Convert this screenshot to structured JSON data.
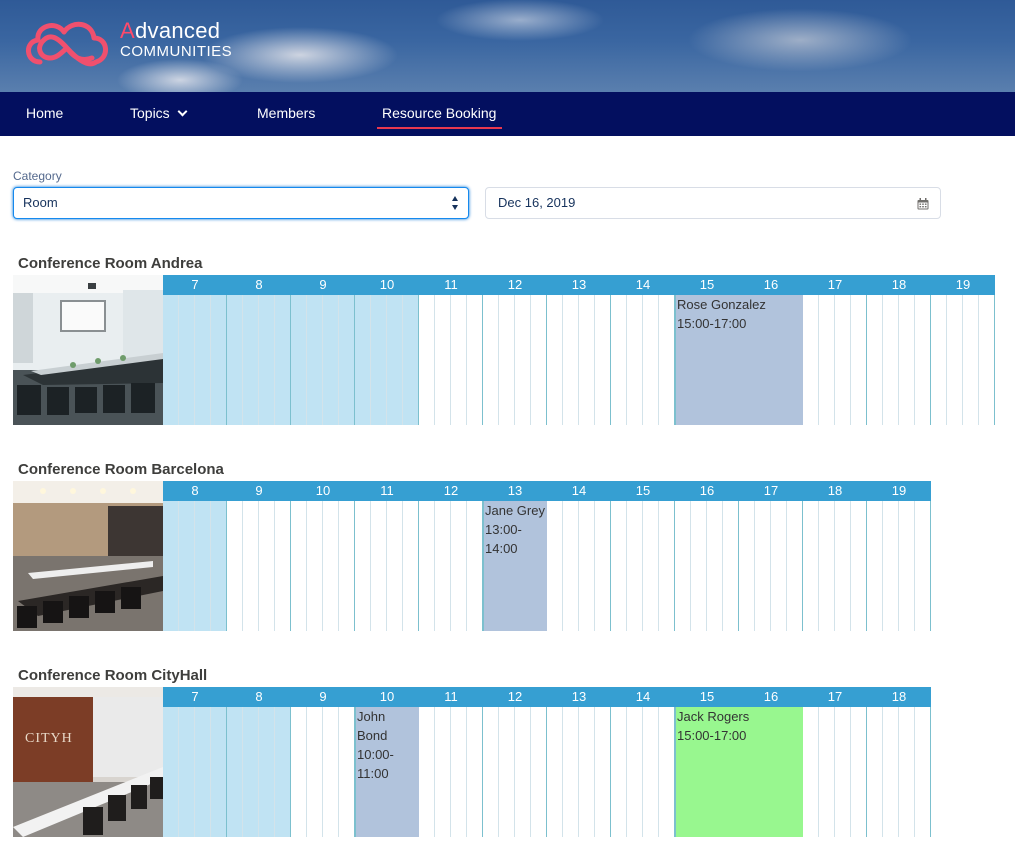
{
  "brand": {
    "line1_first": "A",
    "line1_rest": "dvanced",
    "line2": "COMMUNITIES"
  },
  "nav": {
    "items": [
      {
        "label": "Home"
      },
      {
        "label": "Topics"
      },
      {
        "label": "Members"
      },
      {
        "label": "Resource Booking"
      }
    ]
  },
  "filters": {
    "category_label": "Category",
    "category_value": "Room",
    "date_value": "Dec 16, 2019"
  },
  "rooms": [
    {
      "name": "Conference Room Andrea",
      "hours": [
        "7",
        "8",
        "9",
        "10",
        "11",
        "12",
        "13",
        "14",
        "15",
        "16",
        "17",
        "18",
        "19"
      ],
      "first_hour": 7,
      "slots_per_hour": 4,
      "total_slots": 52,
      "past_slots": 16,
      "bookings": [
        {
          "name": "Rose Gonzalez",
          "time1": "15:00-17:00",
          "time2": "",
          "start": 15,
          "end": 17,
          "color": "blue"
        }
      ]
    },
    {
      "name": "Conference Room Barcelona",
      "hours": [
        "8",
        "9",
        "10",
        "11",
        "12",
        "13",
        "14",
        "15",
        "16",
        "17",
        "18",
        "19"
      ],
      "first_hour": 8,
      "slots_per_hour": 4,
      "total_slots": 48,
      "past_slots": 4,
      "bookings": [
        {
          "name": "Jane Grey",
          "time1": "13:00-",
          "time2": "14:00",
          "start": 13,
          "end": 14,
          "color": "blue"
        }
      ]
    },
    {
      "name": "Conference Room CityHall",
      "hours": [
        "7",
        "8",
        "9",
        "10",
        "11",
        "12",
        "13",
        "14",
        "15",
        "16",
        "17",
        "18"
      ],
      "first_hour": 7,
      "slots_per_hour": 4,
      "total_slots": 48,
      "past_slots": 8,
      "bookings": [
        {
          "name": "John Bond",
          "time1": "10:00-",
          "time2": "11:00",
          "start": 10,
          "end": 11,
          "color": "blue"
        },
        {
          "name": "Jack Rogers",
          "time1": "15:00-17:00",
          "time2": "",
          "start": 15,
          "end": 17,
          "color": "green"
        }
      ]
    }
  ],
  "colors": {
    "nav_bg": "#030f5f",
    "hour_header": "#369fd2",
    "past_slot": "#c0e3f3",
    "booking_blue": "#b1c3dc",
    "booking_green": "#98f78f",
    "active_underline": "#e8384f"
  }
}
